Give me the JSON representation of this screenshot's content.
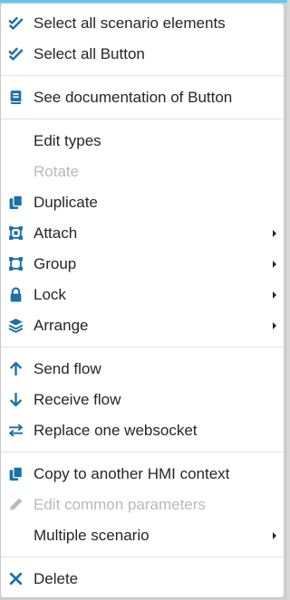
{
  "colors": {
    "icon_blue": "#1e6fa8",
    "disabled_gray": "#b9b9b9",
    "text": "#262626"
  },
  "menu": {
    "groups": [
      [
        {
          "label": "Select all scenario elements",
          "icon": "double-check-icon"
        },
        {
          "label": "Select all Button",
          "icon": "double-check-icon"
        }
      ],
      [
        {
          "label": "See documentation of Button",
          "icon": "book-icon"
        }
      ],
      [
        {
          "label": "Edit types",
          "icon": ""
        },
        {
          "label": "Rotate",
          "icon": "",
          "disabled": true
        },
        {
          "label": "Duplicate",
          "icon": "copy-icon"
        },
        {
          "label": "Attach",
          "icon": "attach-icon",
          "submenu": true
        },
        {
          "label": "Group",
          "icon": "group-icon",
          "submenu": true
        },
        {
          "label": "Lock",
          "icon": "lock-icon",
          "submenu": true
        },
        {
          "label": "Arrange",
          "icon": "layers-icon",
          "submenu": true
        }
      ],
      [
        {
          "label": "Send flow",
          "icon": "arrow-up-icon"
        },
        {
          "label": "Receive flow",
          "icon": "arrow-down-icon"
        },
        {
          "label": "Replace one websocket",
          "icon": "exchange-icon"
        }
      ],
      [
        {
          "label": "Copy to another HMI context",
          "icon": "copy-icon"
        },
        {
          "label": "Edit common parameters",
          "icon": "pencil-icon",
          "disabled": true
        },
        {
          "label": "Multiple scenario",
          "icon": "",
          "submenu": true
        }
      ],
      [
        {
          "label": "Delete",
          "icon": "close-icon"
        }
      ]
    ]
  }
}
